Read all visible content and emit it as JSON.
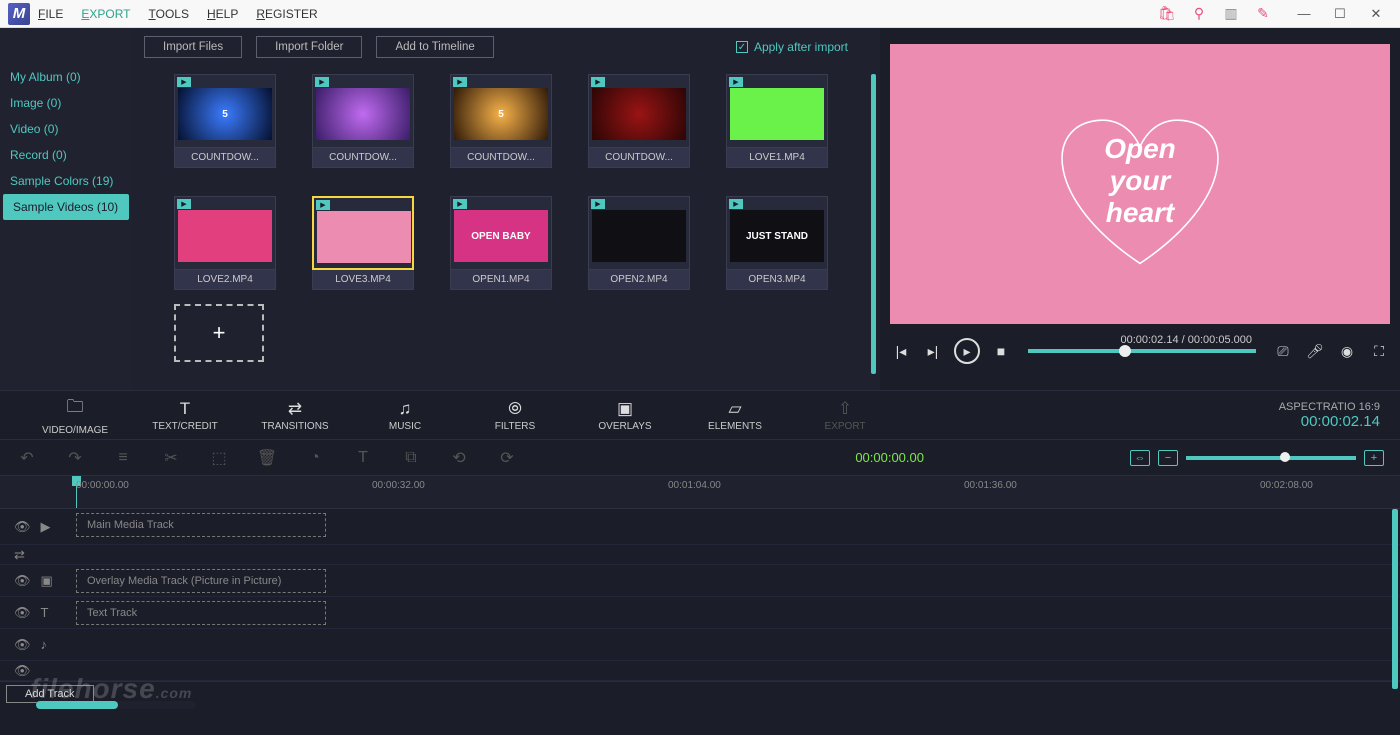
{
  "menu": {
    "file": "FILE",
    "export": "EXPORT",
    "tools": "TOOLS",
    "help": "HELP",
    "register": "REGISTER"
  },
  "sidebar": {
    "items": [
      {
        "label": "My Album (0)"
      },
      {
        "label": "Image (0)"
      },
      {
        "label": "Video (0)"
      },
      {
        "label": "Record (0)"
      },
      {
        "label": "Sample Colors (19)"
      },
      {
        "label": "Sample Videos (10)"
      }
    ]
  },
  "media_toolbar": {
    "import_files": "Import Files",
    "import_folder": "Import Folder",
    "add_timeline": "Add to Timeline",
    "apply_after": "Apply after import"
  },
  "media": [
    {
      "label": "COUNTDOW...",
      "bg": "radial-gradient(circle,#3b7cff,#05102e)",
      "txt": "5"
    },
    {
      "label": "COUNTDOW...",
      "bg": "radial-gradient(circle,#c06bf0,#3a1d68)",
      "txt": ""
    },
    {
      "label": "COUNTDOW...",
      "bg": "radial-gradient(circle,#f7b24a,#301a08)",
      "txt": "5"
    },
    {
      "label": "COUNTDOW...",
      "bg": "radial-gradient(circle,#9a1414,#2c0505)",
      "txt": ""
    },
    {
      "label": "LOVE1.MP4",
      "bg": "#6bf24a",
      "txt": ""
    },
    {
      "label": "LOVE2.MP4",
      "bg": "#e23f7e",
      "txt": ""
    },
    {
      "label": "LOVE3.MP4",
      "bg": "#ec8cb0",
      "txt": "",
      "selected": true
    },
    {
      "label": "OPEN1.MP4",
      "bg": "#d63384",
      "txt": "OPEN BABY"
    },
    {
      "label": "OPEN2.MP4",
      "bg": "#101014",
      "txt": ""
    },
    {
      "label": "OPEN3.MP4",
      "bg": "#101014",
      "txt": "JUST STAND"
    }
  ],
  "preview": {
    "heart_line1": "Open",
    "heart_line2": "your",
    "heart_line3": "heart",
    "time_current": "00:00:02.14",
    "time_total": "00:00:05.000"
  },
  "tabs": {
    "video_image": "VIDEO/IMAGE",
    "text_credit": "TEXT/CREDIT",
    "transitions": "TRANSITIONS",
    "music": "MUSIC",
    "filters": "FILTERS",
    "overlays": "OVERLAYS",
    "elements": "ELEMENTS",
    "export": "EXPORT",
    "aspect": "ASPECTRATIO 16:9",
    "timecode": "00:00:02.14"
  },
  "toolrow_time": "00:00:00.00",
  "ruler": [
    "00:00:00.00",
    "00:00:32.00",
    "00:01:04.00",
    "00:01:36.00",
    "00:02:08.00"
  ],
  "tracks": {
    "main": "Main Media Track",
    "overlay": "Overlay Media Track (Picture in Picture)",
    "text": "Text Track"
  },
  "bottom": {
    "add_track": "Add Track"
  },
  "watermark": {
    "name": "filehorse",
    "suffix": ".com"
  }
}
